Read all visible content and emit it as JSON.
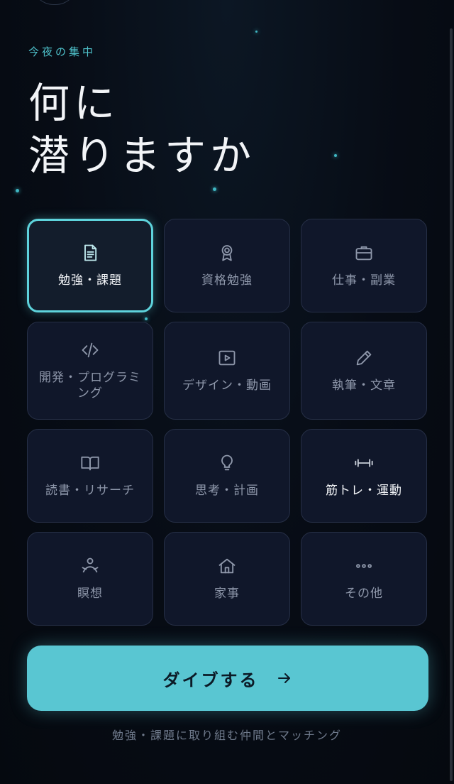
{
  "header": {
    "eyebrow": "今夜の集中",
    "headline_line1": "何に",
    "headline_line2": "潜りますか"
  },
  "categories": [
    {
      "label": "勉強・課題",
      "icon": "document-icon",
      "selected": true
    },
    {
      "label": "資格勉強",
      "icon": "certificate-icon"
    },
    {
      "label": "仕事・副業",
      "icon": "briefcase-icon"
    },
    {
      "label": "開発・プログラミング",
      "icon": "code-icon"
    },
    {
      "label": "デザイン・動画",
      "icon": "video-play-icon"
    },
    {
      "label": "執筆・文章",
      "icon": "pencil-icon"
    },
    {
      "label": "読書・リサーチ",
      "icon": "book-icon"
    },
    {
      "label": "思考・計画",
      "icon": "lightbulb-icon"
    },
    {
      "label": "筋トレ・運動",
      "icon": "dumbbell-icon"
    },
    {
      "label": "瞑想",
      "icon": "meditation-person-icon"
    },
    {
      "label": "家事",
      "icon": "house-icon"
    },
    {
      "label": "その他",
      "icon": "more-dots-icon"
    }
  ],
  "cta": {
    "label": "ダイブする",
    "icon": "arrow-right-icon"
  },
  "footnote": "勉強・課題に取り組む仲間とマッチング",
  "colors": {
    "accent": "#59c6d2",
    "background": "#070c15",
    "card": "#10172a"
  }
}
